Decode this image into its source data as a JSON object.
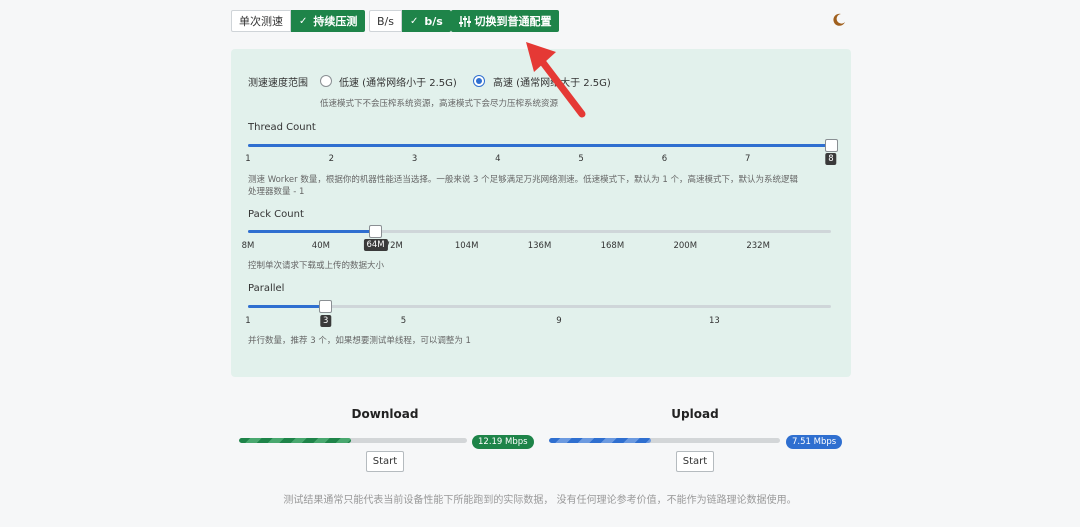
{
  "toolbar": {
    "mode_single": "单次测速",
    "mode_continuous": "持续压测",
    "unit_bytes": "B/s",
    "unit_bits": "b/s",
    "switch_label": "切换到普通配置",
    "check_glyph": "✓"
  },
  "icons": {
    "sliders": "sliders-icon",
    "moon": "moon-icon",
    "check": "check-icon"
  },
  "settings": {
    "speed_range_label": "测速速度范围",
    "low_option": "低速 (通常网络小于 2.5G)",
    "high_option": "高速 (通常网络大于 2.5G)",
    "selected": "high",
    "speed_hint": "低速模式下不会压榨系统资源，高速模式下会尽力压榨系统资源",
    "thread": {
      "label": "Thread Count",
      "ticks": [
        "1",
        "2",
        "3",
        "4",
        "5",
        "6",
        "7",
        "8"
      ],
      "min": 1,
      "max": 8,
      "value": 8,
      "value_label": "8",
      "hint_line1": "测速 Worker 数量，根据你的机器性能适当选择。一般来说 3 个足够满足万兆网络测速。低速模式下，默认为 1 个，高速模式下，默认为系统逻辑",
      "hint_line2": "处理器数量 - 1"
    },
    "pack": {
      "label": "Pack Count",
      "ticks": [
        "8M",
        "40M",
        "72M",
        "104M",
        "136M",
        "168M",
        "200M",
        "232M"
      ],
      "min": 8,
      "max": 264,
      "value": 64,
      "value_label": "64M",
      "hint": "控制单次请求下载或上传的数据大小"
    },
    "parallel": {
      "label": "Parallel",
      "ticks": [
        "1",
        "5",
        "9",
        "13"
      ],
      "tick_values": [
        1,
        5,
        9,
        13
      ],
      "min": 1,
      "max": 16,
      "value": 3,
      "value_label": "3",
      "hint": "并行数量，推荐 3 个，如果想要测试单线程，可以调整为 1"
    }
  },
  "download": {
    "title": "Download",
    "speed": "12.19 Mbps",
    "progress": 0.49,
    "start": "Start"
  },
  "upload": {
    "title": "Upload",
    "speed": "7.51 Mbps",
    "progress": 0.44,
    "start": "Start"
  },
  "footer": "测试结果通常只能代表当前设备性能下所能跑到的实际数据， 没有任何理论参考价值，不能作为链路理论数据使用。",
  "colors": {
    "accent_green": "#1e8449",
    "accent_blue": "#2f6fd0",
    "panel_bg": "#e2f1ec",
    "arrow": "#e53935"
  }
}
